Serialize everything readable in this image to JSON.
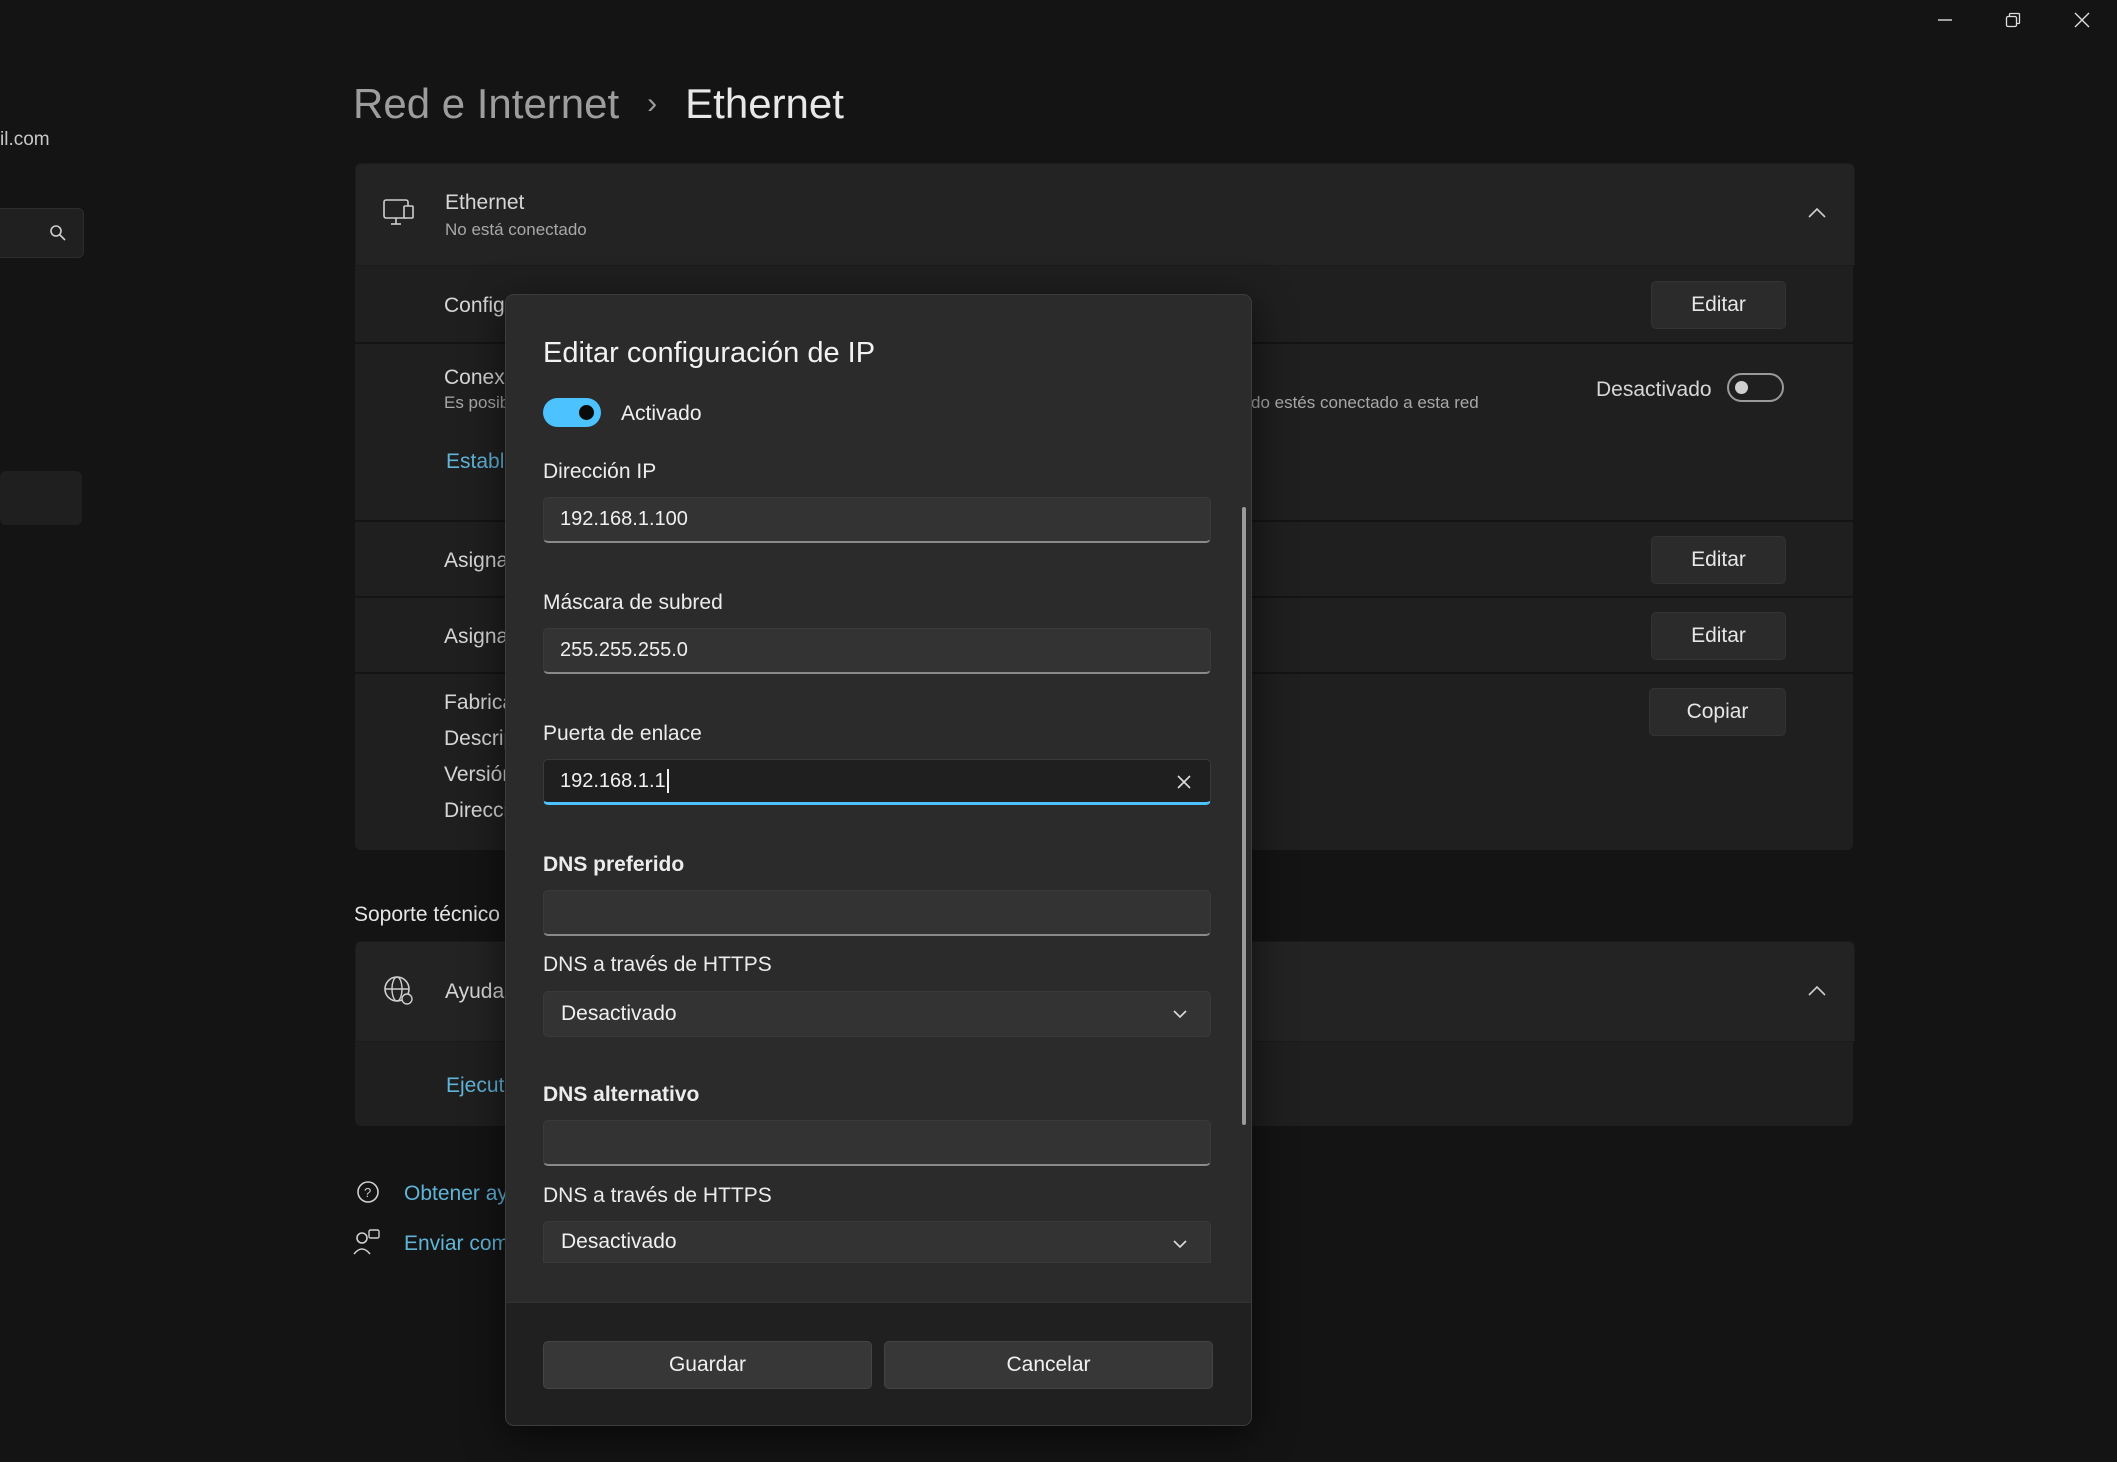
{
  "window": {
    "minimize_icon": "minimize-icon",
    "restore_icon": "restore-icon",
    "close_icon": "close-icon"
  },
  "sidebar": {
    "email_fragment": "il.com",
    "search_icon": "search-icon"
  },
  "breadcrumb": {
    "parent": "Red e Internet",
    "separator": "›",
    "current": "Ethernet"
  },
  "ethernet_card": {
    "title": "Ethernet",
    "status": "No está conectado",
    "rows": {
      "config_label": "Config",
      "config_button": "Editar",
      "metered_label": "Conexi",
      "metered_desc_left": "Es posib",
      "metered_desc_right": "do estés conectado a esta red",
      "metered_toggle_label": "Desactivado",
      "metered_link": "Estable",
      "ip_assign_label": "Asigna",
      "ip_assign_button": "Editar",
      "dns_assign_label": "Asigna",
      "dns_assign_button": "Editar",
      "props": [
        "Fabrica",
        "Descrip",
        "Versión",
        "Direcci"
      ],
      "copy_button": "Copiar"
    }
  },
  "support": {
    "heading": "Soporte técnico",
    "help_label": "Ayuda",
    "run_link": "Ejecuta",
    "get_help": "Obtener ay",
    "send_feedback": "Enviar com"
  },
  "dialog": {
    "title": "Editar configuración de IP",
    "toggle_label": "Activado",
    "ip_label": "Dirección IP",
    "ip_value": "192.168.1.100",
    "mask_label": "Máscara de subred",
    "mask_value": "255.255.255.0",
    "gateway_label": "Puerta de enlace",
    "gateway_value": "192.168.1.1",
    "dns_pref_label": "DNS preferido",
    "dns_pref_value": "",
    "doh1_label": "DNS a través de HTTPS",
    "doh1_value": "Desactivado",
    "dns_alt_label": "DNS alternativo",
    "dns_alt_value": "",
    "doh2_label": "DNS a través de HTTPS",
    "doh2_value": "Desactivado",
    "save_button": "Guardar",
    "cancel_button": "Cancelar"
  },
  "colors": {
    "accent": "#4cc2ff",
    "link": "#60b4d8",
    "background": "#141414"
  }
}
